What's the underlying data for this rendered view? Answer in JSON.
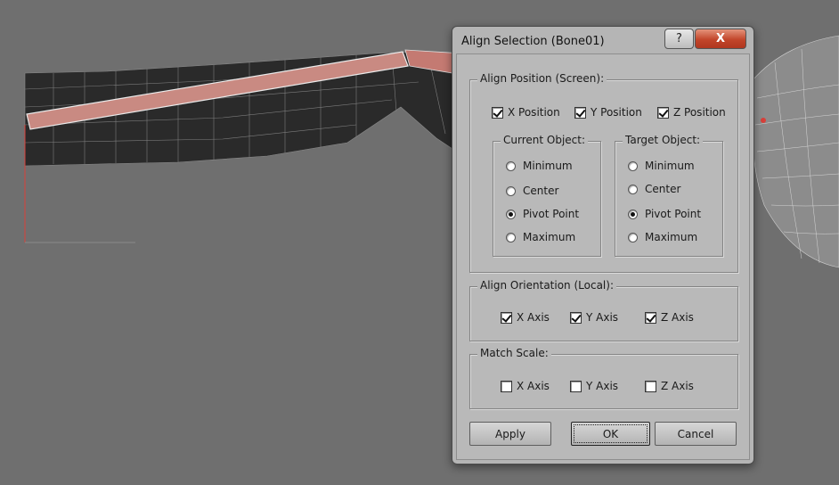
{
  "dialog": {
    "title": "Align Selection (Bone01)",
    "help_glyph": "?",
    "close_glyph": "X"
  },
  "align_position": {
    "legend": "Align Position (Screen):",
    "checkboxes": [
      {
        "label": "X Position",
        "checked": true
      },
      {
        "label": "Y Position",
        "checked": true
      },
      {
        "label": "Z Position",
        "checked": true
      }
    ]
  },
  "current_object": {
    "legend": "Current Object:",
    "options": [
      "Minimum",
      "Center",
      "Pivot Point",
      "Maximum"
    ],
    "selected": "Pivot Point"
  },
  "target_object": {
    "legend": "Target Object:",
    "options": [
      "Minimum",
      "Center",
      "Pivot Point",
      "Maximum"
    ],
    "selected": "Pivot Point"
  },
  "align_orientation": {
    "legend": "Align Orientation (Local):",
    "checkboxes": [
      {
        "label": "X Axis",
        "checked": true
      },
      {
        "label": "Y Axis",
        "checked": true
      },
      {
        "label": "Z Axis",
        "checked": true
      }
    ]
  },
  "match_scale": {
    "legend": "Match Scale:",
    "checkboxes": [
      {
        "label": "X Axis",
        "checked": false
      },
      {
        "label": "Y Axis",
        "checked": false
      },
      {
        "label": "Z Axis",
        "checked": false
      }
    ]
  },
  "buttons": {
    "apply": "Apply",
    "ok": "OK",
    "cancel": "Cancel"
  },
  "colors": {
    "viewport_bg": "#6f6f6f",
    "bone": "#c98a82",
    "mesh_dark": "#242424",
    "close_button": "#c2452a"
  }
}
